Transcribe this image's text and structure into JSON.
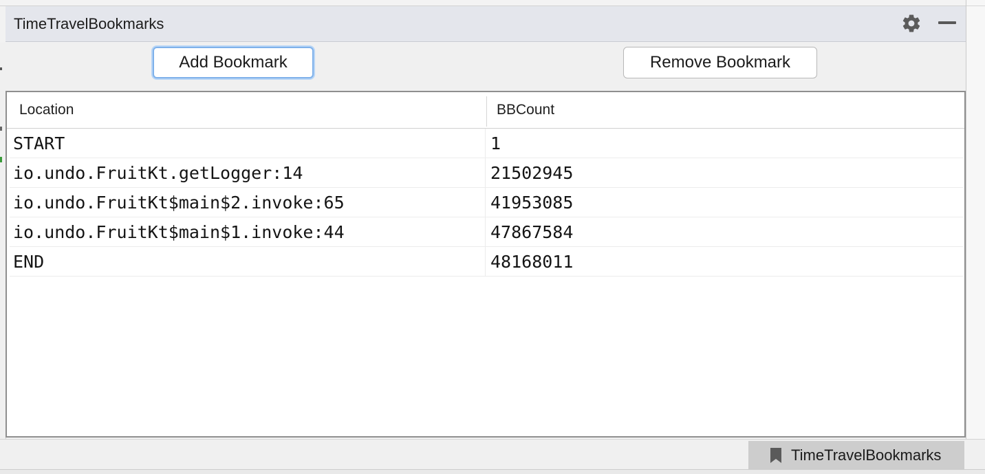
{
  "panel": {
    "title": "TimeTravelBookmarks",
    "settings_icon": "gear-icon",
    "minimize_icon": "minimize-icon"
  },
  "toolbar": {
    "add_label": "Add Bookmark",
    "remove_label": "Remove Bookmark"
  },
  "table": {
    "columns": [
      "Location",
      "BBCount"
    ],
    "rows": [
      {
        "location": "START",
        "bbcount": "1"
      },
      {
        "location": "io.undo.FruitKt.getLogger:14",
        "bbcount": "21502945"
      },
      {
        "location": "io.undo.FruitKt$main$2.invoke:65",
        "bbcount": "41953085"
      },
      {
        "location": "io.undo.FruitKt$main$1.invoke:44",
        "bbcount": "47867584"
      },
      {
        "location": "END",
        "bbcount": "48168011"
      }
    ]
  },
  "bottom_tab": {
    "label": "TimeTravelBookmarks",
    "icon": "bookmark-icon"
  },
  "colors": {
    "header_bg": "#e4e6ec",
    "focus_ring": "#7fb1ea",
    "tab_bg": "#cdcdcd"
  }
}
